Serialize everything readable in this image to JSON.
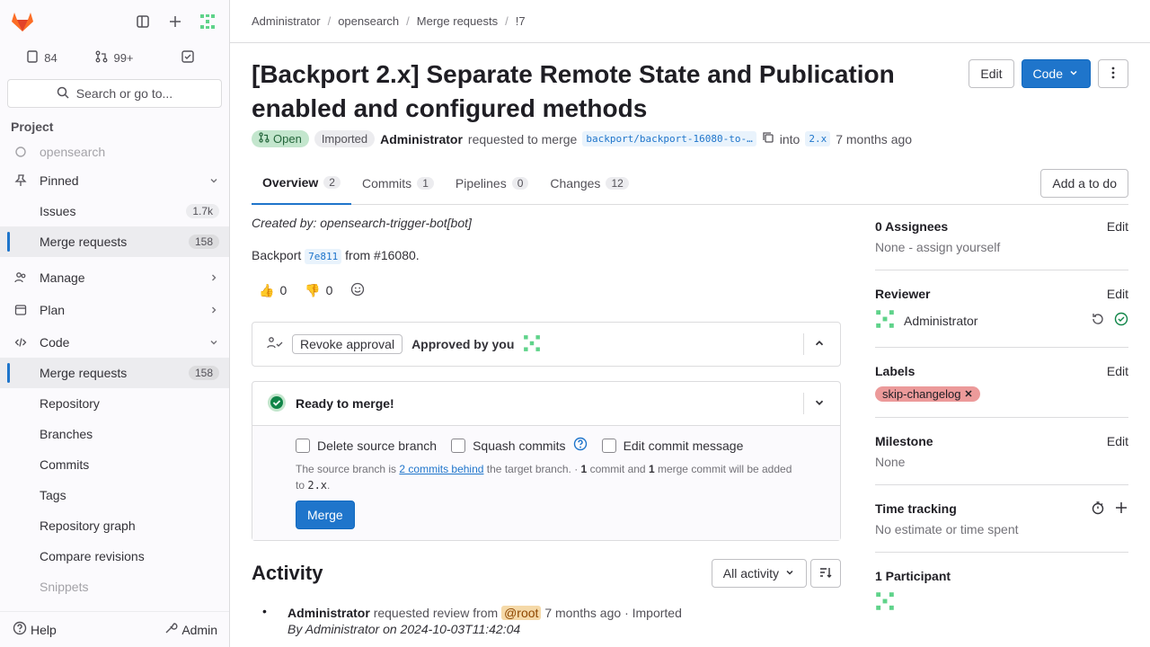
{
  "sidebar": {
    "counts": {
      "issues": "84",
      "merge_requests": "99+"
    },
    "search_label": "Search or go to...",
    "section": "Project",
    "project_name": "opensearch",
    "items": {
      "pinned": "Pinned",
      "issues": "Issues",
      "issues_count": "1.7k",
      "pinned_mr": "Merge requests",
      "pinned_mr_count": "158",
      "manage": "Manage",
      "plan": "Plan",
      "code": "Code",
      "code_mr": "Merge requests",
      "code_mr_count": "158",
      "repository": "Repository",
      "branches": "Branches",
      "commits": "Commits",
      "tags": "Tags",
      "repo_graph": "Repository graph",
      "compare": "Compare revisions",
      "snippets": "Snippets"
    },
    "help": "Help",
    "admin": "Admin"
  },
  "breadcrumb": [
    "Administrator",
    "opensearch",
    "Merge requests",
    "!7"
  ],
  "mr": {
    "title": "[Backport 2.x] Separate Remote State and Publication enabled and configured methods",
    "edit": "Edit",
    "code": "Code",
    "status": "Open",
    "imported": "Imported",
    "author": "Administrator",
    "requested": "requested to merge",
    "source_branch": "backport/backport-16080-to-…",
    "into": "into",
    "target_branch": "2.x",
    "age": "7 months ago"
  },
  "tabs": [
    {
      "label": "Overview",
      "count": "2"
    },
    {
      "label": "Commits",
      "count": "1"
    },
    {
      "label": "Pipelines",
      "count": "0"
    },
    {
      "label": "Changes",
      "count": "12"
    }
  ],
  "todo": "Add a to do",
  "description": {
    "created_by": "Created by: opensearch-trigger-bot[bot]",
    "backport_prefix": "Backport",
    "commit": "7e811",
    "backport_suffix": "from #16080."
  },
  "reactions": {
    "up": "0",
    "down": "0"
  },
  "approval": {
    "revoke": "Revoke approval",
    "approved": "Approved by you"
  },
  "merge": {
    "ready": "Ready to merge!",
    "delete_branch": "Delete source branch",
    "squash": "Squash commits",
    "edit_msg": "Edit commit message",
    "info_1": "The source branch is",
    "behind_link": "2 commits behind",
    "info_2": "the target branch. ·",
    "commit_n": "1",
    "info_3": "commit and",
    "merge_n": "1",
    "info_4": "merge commit will be added to",
    "info_branch": "2.x",
    "button": "Merge"
  },
  "activity": {
    "title": "Activity",
    "filter": "All activity",
    "event_author": "Administrator",
    "event_text": "requested review from",
    "event_target": "@root",
    "event_age": "7 months ago",
    "event_imported": "· Imported",
    "event_by": "By Administrator on 2024-10-03T11:42:04"
  },
  "right": {
    "assignees_h": "0 Assignees",
    "assignees_v": "None - assign yourself",
    "reviewer_h": "Reviewer",
    "reviewer_v": "Administrator",
    "labels_h": "Labels",
    "label": "skip-changelog",
    "milestone_h": "Milestone",
    "milestone_v": "None",
    "time_h": "Time tracking",
    "time_v": "No estimate or time spent",
    "participants_h": "1 Participant",
    "edit": "Edit"
  },
  "colors": {
    "accent": "#1f75cb",
    "success": "#108548",
    "label": "#ec9a9a"
  }
}
